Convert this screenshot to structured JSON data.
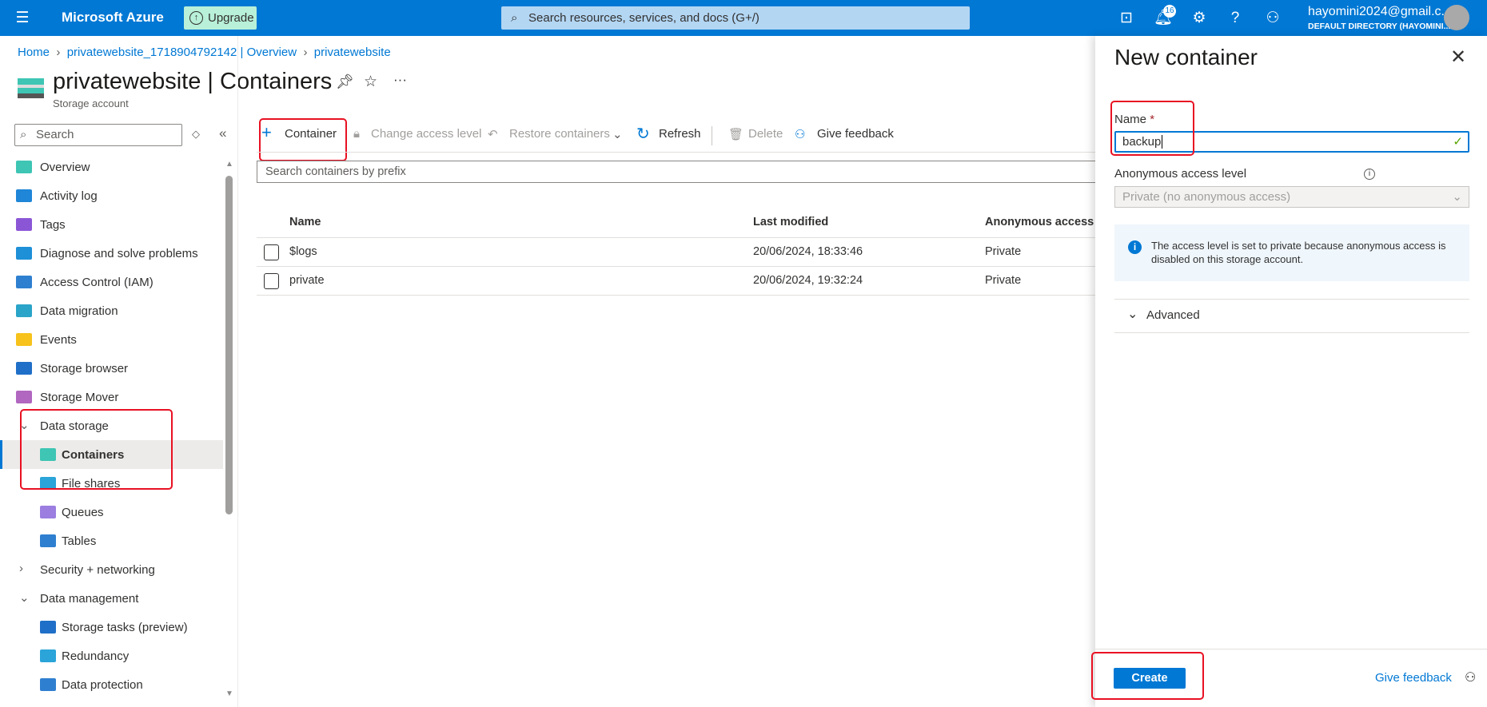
{
  "topbar": {
    "brand": "Microsoft Azure",
    "upgrade": "Upgrade",
    "search_placeholder": "Search resources, services, and docs (G+/)",
    "notifications": "16",
    "user_email": "hayomini2024@gmail.c...",
    "user_directory": "DEFAULT DIRECTORY (HAYOMINI..."
  },
  "breadcrumb": [
    "Home",
    "privatewebsite_1718904792142 | Overview",
    "privatewebsite"
  ],
  "header": {
    "title": "privatewebsite | Containers",
    "subtitle": "Storage account"
  },
  "sidebar": {
    "search_placeholder": "Search",
    "items": [
      {
        "label": "Overview",
        "icon": "overview-icon",
        "color": "#3ec5b4"
      },
      {
        "label": "Activity log",
        "icon": "activity-log-icon",
        "color": "#1f86d8"
      },
      {
        "label": "Tags",
        "icon": "tag-icon",
        "color": "#8b56d6"
      },
      {
        "label": "Diagnose and solve problems",
        "icon": "wrench-icon",
        "color": "#1e90d8"
      },
      {
        "label": "Access Control (IAM)",
        "icon": "people-icon",
        "color": "#2e7fd0"
      },
      {
        "label": "Data migration",
        "icon": "migration-icon",
        "color": "#2aa4c9"
      },
      {
        "label": "Events",
        "icon": "lightning-icon",
        "color": "#f7c21b"
      },
      {
        "label": "Storage browser",
        "icon": "storage-browser-icon",
        "color": "#1f6fc8"
      },
      {
        "label": "Storage Mover",
        "icon": "cloud-icon",
        "color": "#b166c0"
      },
      {
        "label": "Data storage",
        "group": "expanded"
      },
      {
        "label": "Containers",
        "icon": "containers-icon",
        "color": "#3ec5b4",
        "sub": true,
        "selected": true
      },
      {
        "label": "File shares",
        "icon": "file-share-icon",
        "color": "#2aa4d9",
        "sub": true
      },
      {
        "label": "Queues",
        "icon": "queue-icon",
        "color": "#9b7ee0",
        "sub": true
      },
      {
        "label": "Tables",
        "icon": "table-icon",
        "color": "#2e7fd0",
        "sub": true
      },
      {
        "label": "Security + networking",
        "group": "collapsed"
      },
      {
        "label": "Data management",
        "group": "expanded"
      },
      {
        "label": "Storage tasks (preview)",
        "icon": "storage-tasks-icon",
        "color": "#1f6fc8",
        "sub": true
      },
      {
        "label": "Redundancy",
        "icon": "globe-icon",
        "color": "#2aa4d9",
        "sub": true
      },
      {
        "label": "Data protection",
        "icon": "shield-icon",
        "color": "#2e7fd0",
        "sub": true
      }
    ]
  },
  "toolbar": {
    "container": "Container",
    "change_access": "Change access level",
    "restore": "Restore containers",
    "refresh": "Refresh",
    "delete": "Delete",
    "feedback": "Give feedback"
  },
  "containers": {
    "search_placeholder": "Search containers by prefix",
    "columns": [
      "Name",
      "Last modified",
      "Anonymous access le"
    ],
    "rows": [
      {
        "name": "$logs",
        "modified": "20/06/2024, 18:33:46",
        "access": "Private"
      },
      {
        "name": "private",
        "modified": "20/06/2024, 19:32:24",
        "access": "Private"
      }
    ]
  },
  "panel": {
    "title": "New container",
    "name_label": "Name",
    "required": "*",
    "name_value": "backup",
    "access_label": "Anonymous access level",
    "access_value": "Private (no anonymous access)",
    "info": "The access level is set to private because anonymous access is disabled on this storage account.",
    "advanced": "Advanced",
    "create": "Create",
    "feedback": "Give feedback"
  },
  "colors": {
    "accent": "#0078d4",
    "highlight": "#e81123"
  }
}
